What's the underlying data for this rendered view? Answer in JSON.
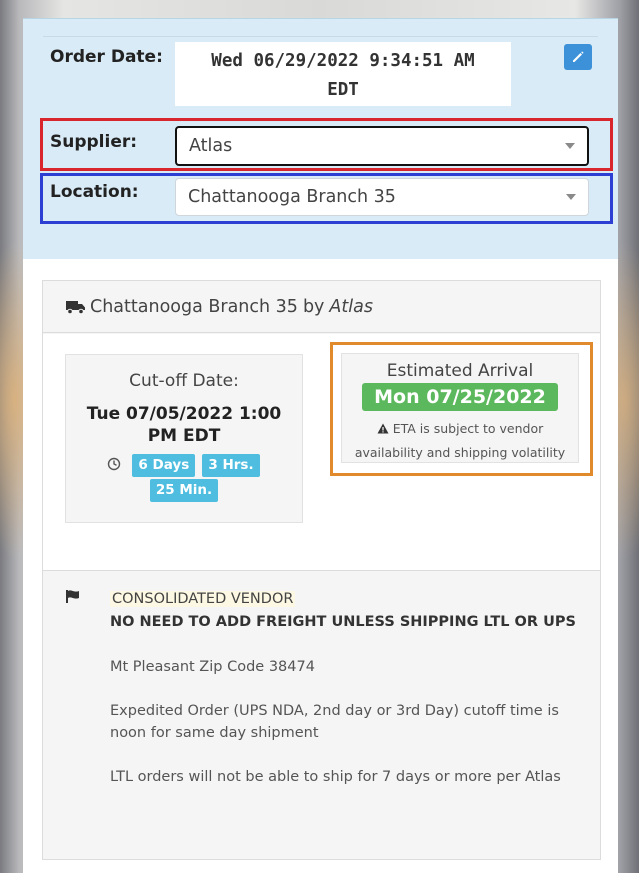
{
  "order_date": {
    "label": "Order Date:",
    "line1": "Wed 06/29/2022 9:34:51 AM",
    "line2": "EDT"
  },
  "supplier": {
    "label": "Supplier:",
    "value": "Atlas"
  },
  "location": {
    "label": "Location:",
    "value": "Chattanooga Branch 35"
  },
  "shipment": {
    "branch": "Chattanooga Branch 35",
    "by": "by",
    "vendor": "Atlas"
  },
  "cutoff": {
    "label": "Cut-off Date:",
    "date_line1": "Tue 07/05/2022 1:00",
    "date_line2": "PM EDT",
    "countdown": {
      "days": "6 Days",
      "hours": "3 Hrs.",
      "minutes": "25 Min."
    }
  },
  "eta": {
    "label": "Estimated Arrival",
    "date": "Mon 07/25/2022",
    "note_line1": "ETA is subject to vendor",
    "note_line2": "availability and shipping volatility"
  },
  "vendor_notes": {
    "tag": "CONSOLIDATED VENDOR",
    "headline": "NO NEED TO ADD FREIGHT UNLESS SHIPPING LTL OR UPS",
    "lines": [
      "Mt Pleasant Zip Code 38474",
      "Expedited Order (UPS NDA, 2nd day or 3rd Day) cutoff time is noon for same day shipment",
      "LTL orders will not be able to ship for 7 days or more per Atlas"
    ]
  },
  "colors": {
    "top_panel": "#d9ebf6",
    "edit_button": "#3c91d9",
    "badge": "#4fbde0",
    "eta_green": "#5cb85c",
    "highlight_supplier": "#d9262c",
    "highlight_location": "#2d3ed2",
    "highlight_eta": "#e08a2c"
  },
  "icons": {
    "edit": "pencil-icon",
    "truck": "truck-icon",
    "clock": "clock-icon",
    "warning": "warning-icon",
    "flag": "flag-icon",
    "select_caret": "caret-down-icon"
  }
}
